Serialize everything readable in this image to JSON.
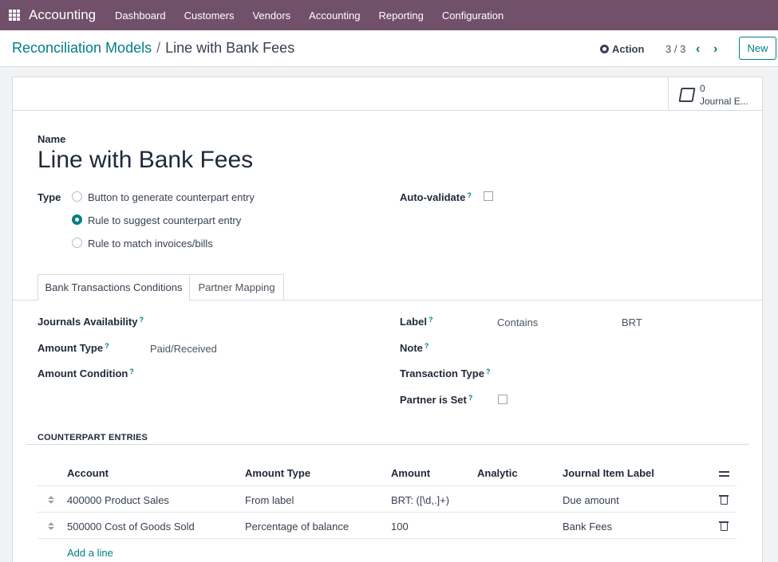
{
  "topbar": {
    "app_name": "Accounting",
    "menu": [
      "Dashboard",
      "Customers",
      "Vendors",
      "Accounting",
      "Reporting",
      "Configuration"
    ]
  },
  "breadcrumb": {
    "parent": "Reconciliation Models",
    "separator": "/",
    "current": "Line with Bank Fees"
  },
  "control": {
    "action_label": "Action",
    "pager": "3 / 3",
    "new_label": "New"
  },
  "smart_button": {
    "value": "0",
    "label": "Journal E..."
  },
  "form": {
    "name_label": "Name",
    "name_value": "Line with Bank Fees",
    "type_label": "Type",
    "type_options": [
      "Button to generate counterpart entry",
      "Rule to suggest counterpart entry",
      "Rule to match invoices/bills"
    ],
    "type_selected": 1,
    "auto_validate_label": "Auto-validate",
    "help_mark": "?"
  },
  "tabs": [
    "Bank Transactions Conditions",
    "Partner Mapping"
  ],
  "conditions": {
    "journals_label": "Journals Availability",
    "amount_type_label": "Amount Type",
    "amount_type_value": "Paid/Received",
    "amount_condition_label": "Amount Condition",
    "label_label": "Label",
    "label_op": "Contains",
    "label_value": "BRT",
    "note_label": "Note",
    "transaction_type_label": "Transaction Type",
    "partner_set_label": "Partner is Set"
  },
  "counterpart": {
    "title": "COUNTERPART ENTRIES",
    "headers": [
      "Account",
      "Amount Type",
      "Amount",
      "Analytic",
      "Journal Item Label"
    ],
    "rows": [
      [
        "400000 Product Sales",
        "From label",
        "BRT: ([\\d,.]+)",
        "",
        "Due amount"
      ],
      [
        "500000 Cost of Goods Sold",
        "Percentage of balance",
        "100",
        "",
        "Bank Fees"
      ]
    ],
    "add_line": "Add a line"
  }
}
